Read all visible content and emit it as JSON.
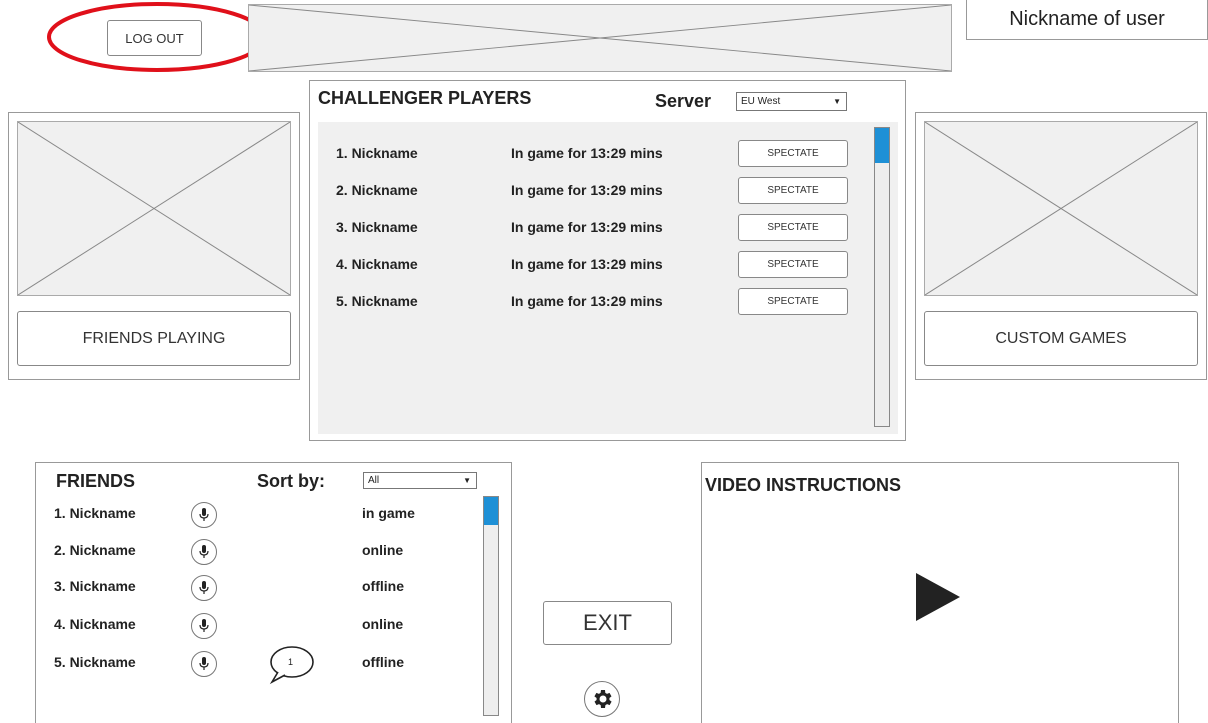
{
  "header": {
    "logout_label": "LOG OUT",
    "banner_icon": "image-placeholder-icon",
    "nickname": "Nickname of user"
  },
  "challenger": {
    "title": "CHALLENGER PLAYERS",
    "server_label": "Server",
    "server_value": "EU West",
    "spectate_label": "SPECTATE",
    "rows": [
      {
        "name": "1. Nickname",
        "status": "In game for 13:29 mins"
      },
      {
        "name": "2. Nickname",
        "status": "In game for 13:29 mins"
      },
      {
        "name": "3. Nickname",
        "status": "In game for 13:29 mins"
      },
      {
        "name": "4. Nickname",
        "status": "In game for 13:29 mins"
      },
      {
        "name": "5. Nickname",
        "status": "In game for 13:29 mins"
      }
    ]
  },
  "left_card": {
    "button_label": "FRIENDS PLAYING",
    "image_icon": "image-placeholder-icon"
  },
  "right_card": {
    "button_label": "CUSTOM GAMES",
    "image_icon": "image-placeholder-icon"
  },
  "friends": {
    "title": "FRIENDS",
    "sort_label": "Sort by:",
    "sort_value": "All",
    "rows": [
      {
        "name": "1. Nickname",
        "status": "in game"
      },
      {
        "name": "2. Nickname",
        "status": "online"
      },
      {
        "name": "3. Nickname",
        "status": "offline"
      },
      {
        "name": "4. Nickname",
        "status": "online"
      },
      {
        "name": "5. Nickname",
        "status": "offline"
      }
    ],
    "chat_count": "1"
  },
  "exit_label": "EXIT",
  "video": {
    "title": "VIDEO INSTRUCTIONS",
    "play_icon": "play-icon"
  },
  "colors": {
    "accent_scroll": "#1e90d6",
    "annotation_red": "#e0101a"
  }
}
